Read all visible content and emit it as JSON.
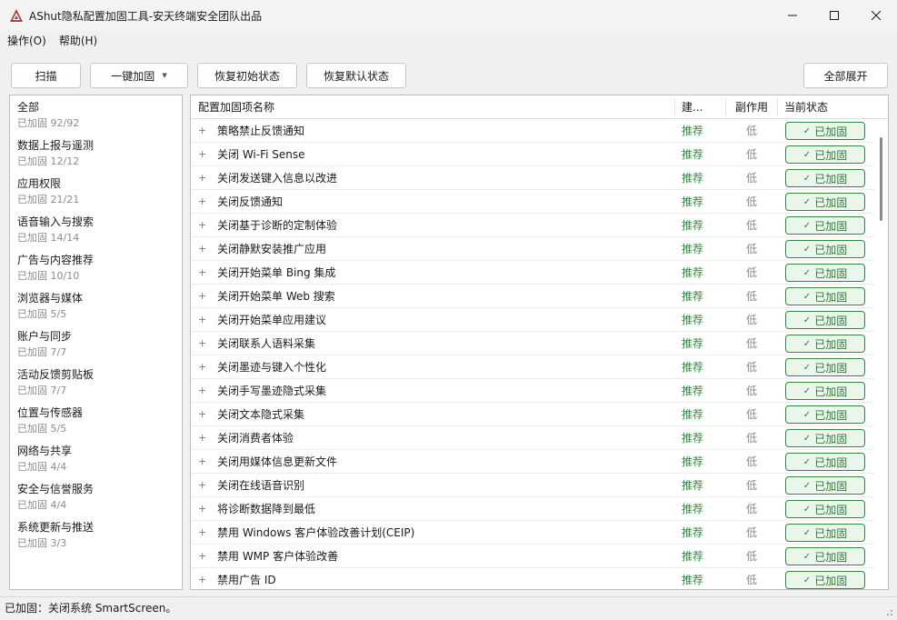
{
  "window": {
    "title": "AShut隐私配置加固工具-安天终端安全团队出品",
    "icon": "ashut-logo-icon"
  },
  "menu": [
    "操作(O)",
    "帮助(H)"
  ],
  "toolbar": {
    "scan": "扫描",
    "harden_all": "一键加固",
    "restore_initial": "恢复初始状态",
    "restore_default": "恢复默认状态",
    "expand_all": "全部展开"
  },
  "sidebar": {
    "items": [
      {
        "name": "全部",
        "status": "已加固 92/92"
      },
      {
        "name": "数据上报与遥测",
        "status": "已加固 12/12"
      },
      {
        "name": "应用权限",
        "status": "已加固 21/21"
      },
      {
        "name": "语音输入与搜索",
        "status": "已加固 14/14"
      },
      {
        "name": "广告与内容推荐",
        "status": "已加固 10/10"
      },
      {
        "name": "浏览器与媒体",
        "status": "已加固 5/5"
      },
      {
        "name": "账户与同步",
        "status": "已加固 7/7"
      },
      {
        "name": "活动反馈剪贴板",
        "status": "已加固 7/7"
      },
      {
        "name": "位置与传感器",
        "status": "已加固 5/5"
      },
      {
        "name": "网络与共享",
        "status": "已加固 4/4"
      },
      {
        "name": "安全与信誉服务",
        "status": "已加固 4/4"
      },
      {
        "name": "系统更新与推送",
        "status": "已加固 3/3"
      }
    ]
  },
  "table": {
    "columns": [
      "配置加固项名称",
      "建...",
      "副作用",
      "当前状态"
    ],
    "rows": [
      {
        "name": "策略禁止反馈通知",
        "suggest": "推荐",
        "side": "低",
        "status": "已加固"
      },
      {
        "name": "关闭 Wi-Fi Sense",
        "suggest": "推荐",
        "side": "低",
        "status": "已加固"
      },
      {
        "name": "关闭发送键入信息以改进",
        "suggest": "推荐",
        "side": "低",
        "status": "已加固"
      },
      {
        "name": "关闭反馈通知",
        "suggest": "推荐",
        "side": "低",
        "status": "已加固"
      },
      {
        "name": "关闭基于诊断的定制体验",
        "suggest": "推荐",
        "side": "低",
        "status": "已加固"
      },
      {
        "name": "关闭静默安装推广应用",
        "suggest": "推荐",
        "side": "低",
        "status": "已加固"
      },
      {
        "name": "关闭开始菜单 Bing 集成",
        "suggest": "推荐",
        "side": "低",
        "status": "已加固"
      },
      {
        "name": "关闭开始菜单 Web 搜索",
        "suggest": "推荐",
        "side": "低",
        "status": "已加固"
      },
      {
        "name": "关闭开始菜单应用建议",
        "suggest": "推荐",
        "side": "低",
        "status": "已加固"
      },
      {
        "name": "关闭联系人语料采集",
        "suggest": "推荐",
        "side": "低",
        "status": "已加固"
      },
      {
        "name": "关闭墨迹与键入个性化",
        "suggest": "推荐",
        "side": "低",
        "status": "已加固"
      },
      {
        "name": "关闭手写墨迹隐式采集",
        "suggest": "推荐",
        "side": "低",
        "status": "已加固"
      },
      {
        "name": "关闭文本隐式采集",
        "suggest": "推荐",
        "side": "低",
        "status": "已加固"
      },
      {
        "name": "关闭消费者体验",
        "suggest": "推荐",
        "side": "低",
        "status": "已加固"
      },
      {
        "name": "关闭用媒体信息更新文件",
        "suggest": "推荐",
        "side": "低",
        "status": "已加固"
      },
      {
        "name": "关闭在线语音识别",
        "suggest": "推荐",
        "side": "低",
        "status": "已加固"
      },
      {
        "name": "将诊断数据降到最低",
        "suggest": "推荐",
        "side": "低",
        "status": "已加固"
      },
      {
        "name": "禁用 Windows 客户体验改善计划(CEIP)",
        "suggest": "推荐",
        "side": "低",
        "status": "已加固"
      },
      {
        "name": "禁用 WMP 客户体验改善",
        "suggest": "推荐",
        "side": "低",
        "status": "已加固"
      },
      {
        "name": "禁用广告 ID",
        "suggest": "推荐",
        "side": "低",
        "status": "已加固"
      }
    ]
  },
  "status_bar": "已加固：关闭系统 SmartScreen。",
  "colors": {
    "accent_green": "#2e8b3d",
    "status_bg": "#eaf5ec",
    "muted_text": "#8c8c8c"
  }
}
